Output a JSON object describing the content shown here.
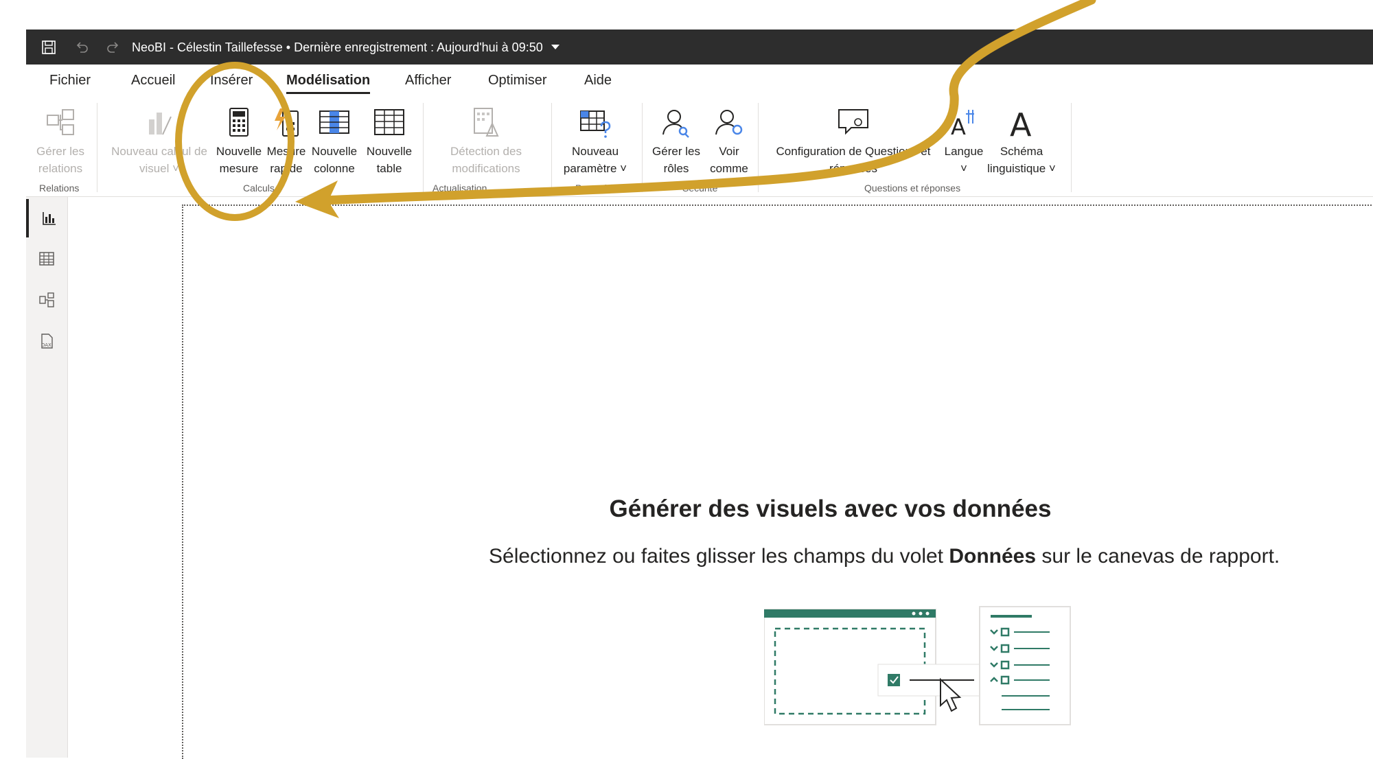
{
  "titlebar": {
    "title": "NeoBI - Célestin Taillefesse • Dernière enregistrement : Aujourd'hui à 09:50"
  },
  "tabs": [
    {
      "label": "Fichier"
    },
    {
      "label": "Accueil"
    },
    {
      "label": "Insérer"
    },
    {
      "label": "Modélisation",
      "active": true
    },
    {
      "label": "Afficher"
    },
    {
      "label": "Optimiser"
    },
    {
      "label": "Aide"
    }
  ],
  "ribbon": {
    "manage_relations": {
      "line1": "Gérer les",
      "line2": "relations"
    },
    "new_visual_calc": {
      "line1": "Nouveau calcul de",
      "line2": "visuel ˅"
    },
    "new_measure": {
      "line1": "Nouvelle",
      "line2": "mesure"
    },
    "quick_measure": {
      "line1": "Mesure",
      "line2": "rapide"
    },
    "new_column": {
      "line1": "Nouvelle",
      "line2": "colonne"
    },
    "new_table": {
      "line1": "Nouvelle",
      "line2": "table"
    },
    "change_detection": {
      "line1": "Détection des",
      "line2": "modifications"
    },
    "new_parameter": {
      "line1": "Nouveau",
      "line2": "paramètre ˅"
    },
    "manage_roles": {
      "line1": "Gérer les",
      "line2": "rôles"
    },
    "view_as": {
      "line1": "Voir",
      "line2": "comme"
    },
    "qa_setup": {
      "line1": "Configuration de Questions et",
      "line2": "réponses"
    },
    "language": {
      "line1": "Langue",
      "line2": "˅"
    },
    "linguistic_schema": {
      "line1": "Schéma",
      "line2": "linguistique ˅"
    },
    "groups": {
      "relations": "Relations",
      "calculations": "Calculs",
      "update": "Actualisation",
      "parameters": "Paramètres",
      "security": "Sécurité",
      "qa": "Questions et réponses"
    }
  },
  "canvas": {
    "title": "Générer des visuels avec vos données",
    "subtitle_prefix": "Sélectionnez ou faites glisser les champs du volet ",
    "subtitle_bold": "Données",
    "subtitle_suffix": " sur le canevas de rapport."
  },
  "colors": {
    "titlebar_bg": "#2d2d2d",
    "annotation_gold": "#d1a12c",
    "illustration_green": "#2f7a66"
  },
  "icons": {
    "save": "save-icon",
    "undo": "undo-icon",
    "redo": "redo-icon",
    "report_view": "report-view-icon",
    "table_view": "table-view-icon",
    "model_view": "model-view-icon",
    "dax_view": "dax-query-icon"
  }
}
